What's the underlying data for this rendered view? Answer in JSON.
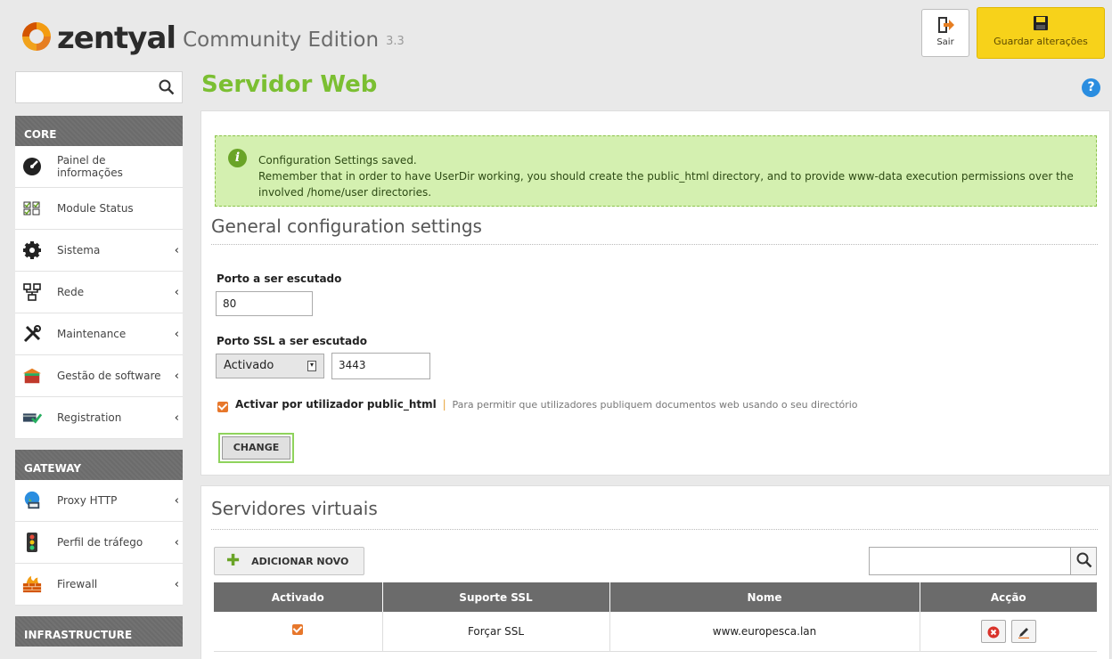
{
  "header": {
    "brand": "zentyal",
    "edition": "Community Edition",
    "version": "3.3",
    "logout_label": "Sair",
    "save_label": "Guardar alterações",
    "save_color": "#f7d21a"
  },
  "search": {
    "placeholder": ""
  },
  "sidebar": {
    "sections": [
      {
        "title": "CORE",
        "items": [
          {
            "label": "Painel de informações",
            "icon": "dashboard-icon"
          },
          {
            "label": "Module Status",
            "icon": "checkbox-grid-icon"
          },
          {
            "label": "Sistema",
            "icon": "gear-icon"
          },
          {
            "label": "Rede",
            "icon": "network-icon"
          },
          {
            "label": "Maintenance",
            "icon": "tools-icon"
          },
          {
            "label": "Gestão de software",
            "icon": "package-icon"
          },
          {
            "label": "Registration",
            "icon": "registration-icon"
          }
        ]
      },
      {
        "title": "GATEWAY",
        "items": [
          {
            "label": "Proxy HTTP",
            "icon": "globe-computer-icon"
          },
          {
            "label": "Perfil de tráfego",
            "icon": "traffic-light-icon"
          },
          {
            "label": "Firewall",
            "icon": "firewall-icon"
          }
        ]
      },
      {
        "title": "INFRASTRUCTURE",
        "items": []
      }
    ],
    "accent_color": "#7bbf32"
  },
  "page": {
    "title": "Servidor Web",
    "help_glyph": "?"
  },
  "notice": {
    "line1": "Configuration Settings saved.",
    "line2": "Remember that in order to have UserDir working, you should create the public_html directory, and to provide www-data execution permissions over the involved /home/user directories."
  },
  "general": {
    "title": "General configuration settings",
    "port_label": "Porto a ser escutado",
    "port_value": "80",
    "ssl_port_label": "Porto SSL a ser escutado",
    "ssl_select_value": "Activado",
    "ssl_port_value": "3443",
    "userdir_label": "Activar por utilizador public_html",
    "userdir_separator": "|",
    "userdir_help": "Para permitir que utilizadores publiquem documentos web usando o seu directório",
    "userdir_checked": true,
    "change_button": "CHANGE"
  },
  "vhosts": {
    "title": "Servidores virtuais",
    "add_button": "ADICIONAR NOVO",
    "search_value": "",
    "columns": [
      "Activado",
      "Suporte SSL",
      "Nome",
      "Acção"
    ],
    "rows": [
      {
        "enabled": true,
        "ssl": "Forçar SSL",
        "name": "www.europesca.lan"
      }
    ]
  }
}
